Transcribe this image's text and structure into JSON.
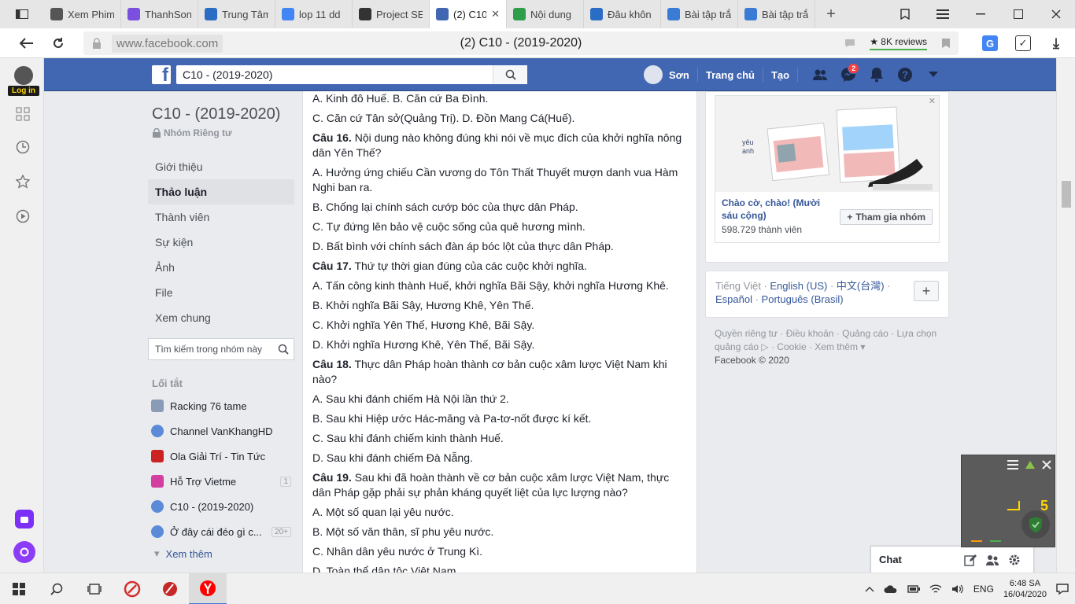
{
  "browser": {
    "tabs": [
      {
        "label": "Xem Phim",
        "icon": "circle-icon",
        "color": "#555555"
      },
      {
        "label": "ThanhSon",
        "icon": "shape-icon",
        "color": "#7b4fe0"
      },
      {
        "label": "Trung Tâm",
        "icon": "grid-icon",
        "color": "#2b6cc4"
      },
      {
        "label": "lop 11 dd",
        "icon": "doc-icon",
        "color": "#4285f4"
      },
      {
        "label": "Project SE",
        "icon": "shield-icon",
        "color": "#333333"
      },
      {
        "label": "(2) C10",
        "icon": "facebook-icon",
        "color": "#4267b2",
        "active": true
      },
      {
        "label": "Nội dung",
        "icon": "app-icon",
        "color": "#2e9e4b"
      },
      {
        "label": "Đâu khôn",
        "icon": "hoc-icon",
        "color": "#2b6cc4"
      },
      {
        "label": "Bài tập trắ",
        "icon": "shield-check-icon",
        "color": "#3a7bd5"
      },
      {
        "label": "Bài tập trắ",
        "icon": "shield-check-icon",
        "color": "#3a7bd5"
      }
    ],
    "url": "www.facebook.com",
    "page_title": "(2) C10 - (2019-2020)",
    "reviews": "★ 8K reviews"
  },
  "yandex": {
    "login": "Log in"
  },
  "fb": {
    "search_value": "C10 - (2019-2020)",
    "user_name": "Sơn",
    "nav_home": "Trang chủ",
    "nav_create": "Tạo",
    "messenger_badge": "2"
  },
  "group": {
    "title": "C10 - (2019-2020)",
    "privacy": "Nhóm Riêng tư",
    "menu": [
      "Giới thiệu",
      "Thảo luận",
      "Thành viên",
      "Sự kiện",
      "Ảnh",
      "File",
      "Xem chung"
    ],
    "active_index": 1,
    "search_placeholder": "Tìm kiếm trong nhóm này",
    "shortcuts_heading": "Lối tắt",
    "shortcuts": [
      {
        "label": "Racking 76 tame",
        "icon": "page-icon",
        "color": "#8a9bb8",
        "count": ""
      },
      {
        "label": "Channel VanKhangHD",
        "icon": "group-icon",
        "color": "#5b8ad8",
        "count": ""
      },
      {
        "label": "Ola Giải Trí - Tin Tức",
        "icon": "ola-icon",
        "color": "#cc2222",
        "count": ""
      },
      {
        "label": "Hỗ Trợ Vietme",
        "icon": "vietme-icon",
        "color": "#d23fa0",
        "count": "1"
      },
      {
        "label": "C10 - (2019-2020)",
        "icon": "group-icon",
        "color": "#5b8ad8",
        "count": ""
      },
      {
        "label": "Ở đây cái đéo gì c...",
        "icon": "group-icon",
        "color": "#5b8ad8",
        "count": "20+"
      }
    ],
    "see_more": "Xem thêm"
  },
  "post": {
    "lines": [
      {
        "bold": "",
        "text": "A. Kinh đô Huế. B. Căn cứ Ba Đình."
      },
      {
        "bold": "",
        "text": "C. Căn cứ Tân sở(Quảng Trị). D. Đồn Mang Cá(Huế)."
      },
      {
        "bold": "Câu 16.",
        "text": " Nội dung nào không đúng khi nói về mục đích của khởi nghĩa nông dân Yên Thế?"
      },
      {
        "bold": "",
        "text": "A. Hưởng ứng chiếu Cần vương do Tôn Thất Thuyết mượn danh vua Hàm Nghi ban ra."
      },
      {
        "bold": "",
        "text": "B. Chống lại chính sách cướp bóc của thực dân Pháp."
      },
      {
        "bold": "",
        "text": "C. Tự đứng lên bảo vệ cuộc sống của quê hương mình."
      },
      {
        "bold": "",
        "text": "D. Bất bình với chính sách đàn áp bóc lột của thực dân Pháp."
      },
      {
        "bold": "Câu 17.",
        "text": " Thứ tự thời gian đúng của các cuộc khởi nghĩa."
      },
      {
        "bold": "",
        "text": "A. Tấn công kinh thành Huế, khởi nghĩa Bãi Sậy, khởi nghĩa Hương Khê."
      },
      {
        "bold": "",
        "text": "B. Khởi nghĩa Bãi Sậy, Hương Khê, Yên Thế."
      },
      {
        "bold": "",
        "text": "C. Khởi nghĩa Yên Thế, Hương Khê, Bãi Sậy."
      },
      {
        "bold": "",
        "text": "D. Khởi nghĩa Hương Khê, Yên Thế, Bãi Sậy."
      },
      {
        "bold": "Câu 18.",
        "text": " Thực dân Pháp hoàn thành cơ bản cuộc xâm lược Việt Nam khi nào?"
      },
      {
        "bold": "",
        "text": "A. Sau khi đánh chiếm Hà Nội lần thứ 2."
      },
      {
        "bold": "",
        "text": "B. Sau khi Hiệp ước Hác-măng và Pa-tơ-nốt được kí kết."
      },
      {
        "bold": "",
        "text": "C. Sau khi đánh chiếm kinh thành Huế."
      },
      {
        "bold": "",
        "text": "D. Sau khi đánh chiếm Đà Nẵng."
      },
      {
        "bold": "Câu 19.",
        "text": " Sau khi đã hoàn thành về cơ bản cuộc xâm lược Việt Nam, thực dân Pháp gặp phải sự phản kháng quyết liệt của lực lượng nào?"
      },
      {
        "bold": "",
        "text": "A. Một số quan lại yêu nước."
      },
      {
        "bold": "",
        "text": "B. Một số văn thân, sĩ phu yêu nước."
      },
      {
        "bold": "",
        "text": "C. Nhân dân yêu nước ở Trung Kì."
      },
      {
        "bold": "",
        "text": "D. Toàn thể dân tộc Việt Nam."
      }
    ]
  },
  "right": {
    "ad_title": "Chào cờ, chào! (Mười sáu cộng)",
    "ad_members": "598.729 thành viên",
    "join_label": "Tham gia nhóm",
    "lang_current": "Tiếng Việt",
    "langs": [
      "English (US)",
      "中文(台灣)",
      "Español",
      "Português (Brasil)"
    ],
    "footer_links": "Quyền riêng tư · Điều khoản · Quảng cáo · Lựa chọn quảng cáo ▷ · Cookie · Xem thêm ▾",
    "copyright": "Facebook © 2020"
  },
  "chat": {
    "label": "Chat"
  },
  "overlay": {
    "number": "5"
  },
  "taskbar": {
    "lang": "ENG",
    "time": "6:48 SA",
    "date": "16/04/2020"
  }
}
